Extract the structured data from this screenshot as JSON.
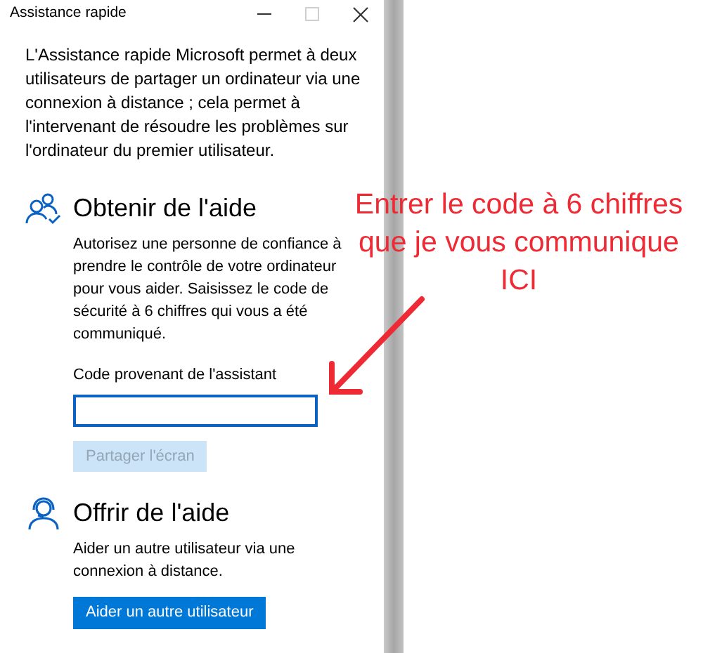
{
  "window": {
    "title": "Assistance rapide",
    "maximize_disabled": true
  },
  "intro": "L'Assistance rapide Microsoft permet à deux utilisateurs de partager un ordinateur via une connexion à distance ; cela permet à l'intervenant de résoudre les problèmes sur l'ordinateur du premier utilisateur.",
  "sections": [
    {
      "kind": "get",
      "heading": "Obtenir de l'aide",
      "description": "Autorisez une personne de confiance à prendre le contrôle de votre ordinateur pour vous aider. Saisissez le code de sécurité à 6 chiffres qui vous a été communiqué.",
      "field": {
        "label": "Code provenant de l'assistant"
      },
      "button": {
        "label": "Partager l'écran",
        "disabled": true
      }
    },
    {
      "kind": "give",
      "heading": "Offrir de l'aide",
      "description": "Aider un autre utilisateur via une connexion à distance.",
      "button": {
        "label": "Aider un autre utilisateur",
        "disabled": false
      }
    }
  ],
  "annotation": {
    "lines": [
      "Entrer le code à 6 chiffres",
      "que je vous communique",
      "ICI"
    ]
  }
}
